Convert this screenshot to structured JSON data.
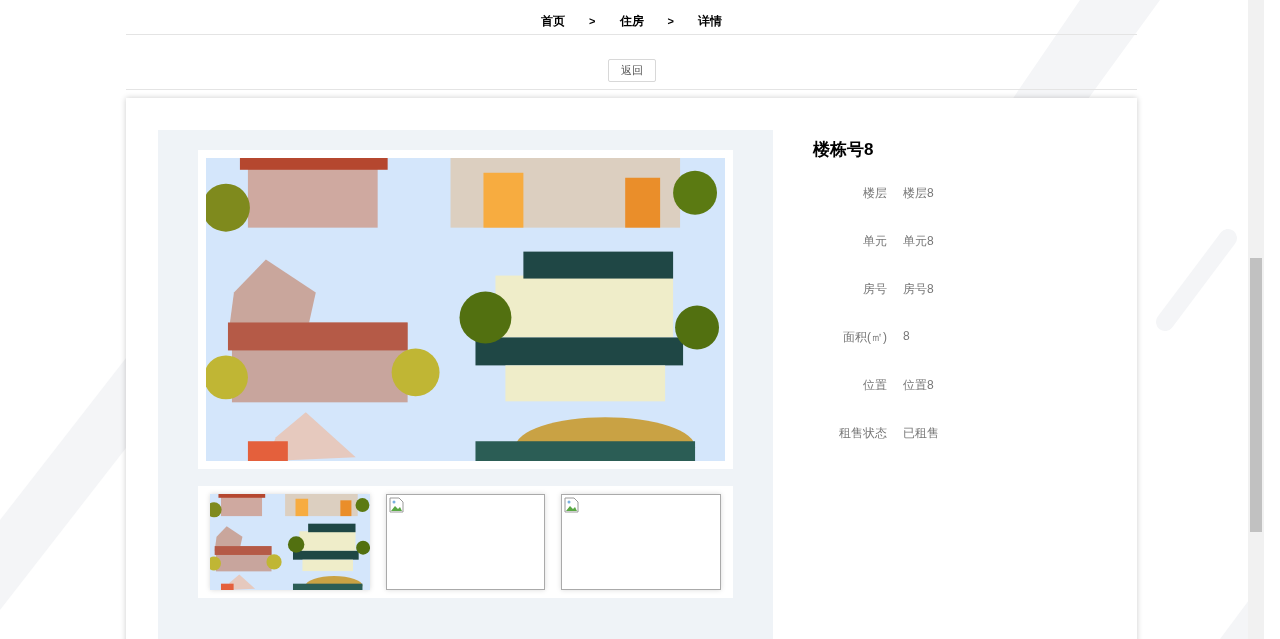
{
  "breadcrumb": [
    {
      "label": "首页",
      "separator": ">"
    },
    {
      "label": "住房",
      "separator": ">"
    },
    {
      "label": "详情"
    }
  ],
  "back_button": "返回",
  "gallery": {
    "main": {
      "kind": "picture"
    },
    "thumbnails": [
      {
        "kind": "picture"
      },
      {
        "kind": "broken"
      },
      {
        "kind": "broken"
      }
    ]
  },
  "details": {
    "title": "楼栋号8",
    "fields": [
      {
        "label": "楼层",
        "value": "楼层8"
      },
      {
        "label": "单元",
        "value": "单元8"
      },
      {
        "label": "房号",
        "value": "房号8"
      },
      {
        "label": "面积(㎡)",
        "value": "8"
      },
      {
        "label": "位置",
        "value": "位置8"
      },
      {
        "label": "租售状态",
        "value": "已租售"
      }
    ]
  }
}
